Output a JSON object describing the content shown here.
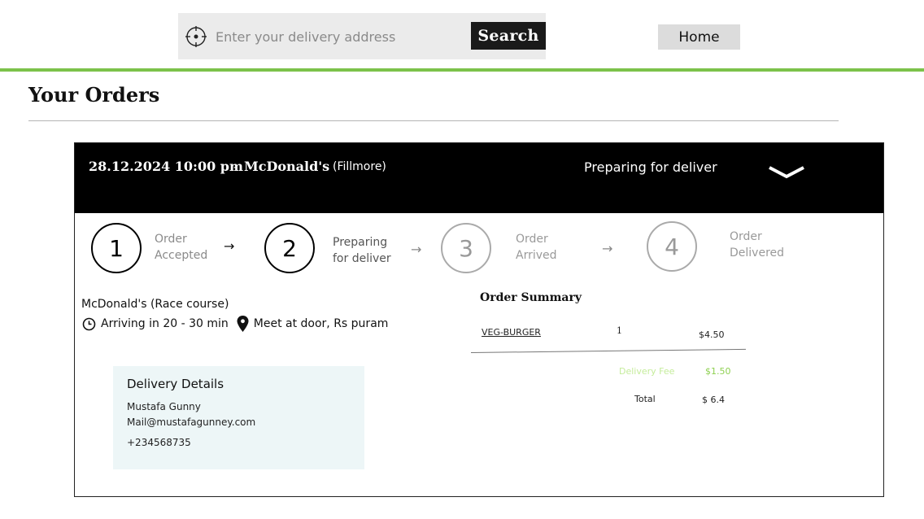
{
  "search": {
    "placeholder": "Enter your delivery address",
    "button_label": "Search",
    "locate_icon": "crosshair-icon"
  },
  "nav": {
    "home_label": "Home"
  },
  "page": {
    "title": "Your Orders",
    "accent_color": "#7cc24a"
  },
  "order": {
    "date_time": "28.12.2024 10:00 pm",
    "separator": "-",
    "restaurant": "McDonald's",
    "branch": "(Fillmore)",
    "status": "Preparing for deliver",
    "expand_icon": "chevron-down-icon",
    "steps": [
      {
        "number": "1",
        "line1": "Order",
        "line2": "Accepted",
        "state": "done"
      },
      {
        "number": "2",
        "line1": "Preparing",
        "line2": "for deliver",
        "state": "current"
      },
      {
        "number": "3",
        "line1": "Order",
        "line2": "Arrived",
        "state": "pending"
      },
      {
        "number": "4",
        "line1": "Order",
        "line2": "Delivered",
        "state": "pending"
      }
    ],
    "step_arrow": "→",
    "restaurant_location": "McDonald's (Race course)",
    "eta": "Arriving in 20 - 30 min",
    "meeting_point": "Meet at door, Rs puram"
  },
  "delivery": {
    "title": "Delivery Details",
    "name": "Mustafa Gunny",
    "email": "Mail@mustafagunney.com",
    "phone": "+234568735"
  },
  "summary": {
    "title": "Order Summary",
    "items": [
      {
        "name": "VEG-BURGER",
        "qty": "1",
        "price": "$4.50"
      }
    ],
    "delivery_fee_label": "Delivery Fee",
    "delivery_fee": "$1.50",
    "total_label": "Total",
    "total": "$ 6.4"
  }
}
